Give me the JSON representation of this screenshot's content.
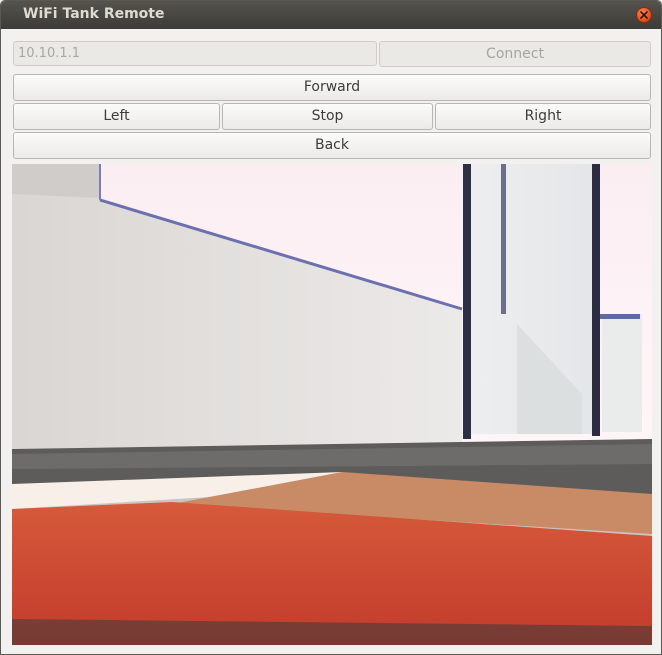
{
  "window": {
    "title": "WiFi Tank Remote"
  },
  "connection": {
    "ip_value": "10.10.1.1",
    "connect_label": "Connect"
  },
  "controls": {
    "forward_label": "Forward",
    "left_label": "Left",
    "stop_label": "Stop",
    "right_label": "Right",
    "back_label": "Back"
  },
  "icons": {
    "close": "close-icon"
  },
  "colors": {
    "titlebar": "#3c3b37",
    "close_button": "#df4a16",
    "window_bg": "#f2f1f0",
    "carpet_red": "#c8462f"
  }
}
